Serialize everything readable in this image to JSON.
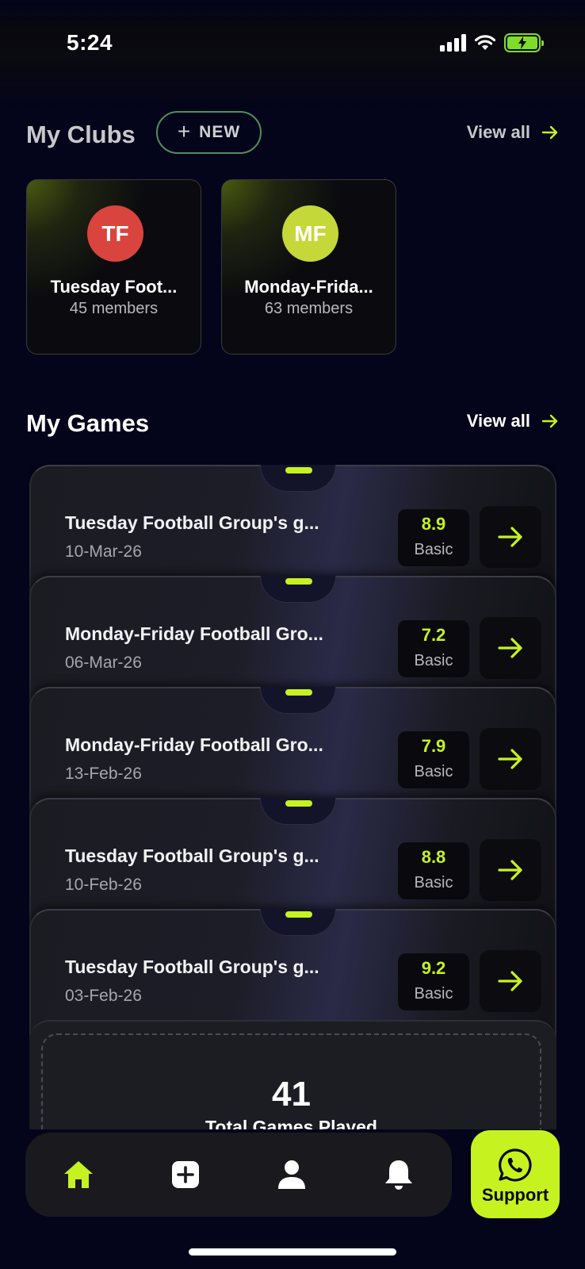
{
  "status_bar": {
    "time": "5:24"
  },
  "clubs": {
    "title": "My Clubs",
    "new_label": "NEW",
    "view_all": "View all",
    "items": [
      {
        "initials": "TF",
        "name": "Tuesday Foot...",
        "members": "45 members",
        "color": "#d9443f"
      },
      {
        "initials": "MF",
        "name": "Monday-Frida...",
        "members": "63 members",
        "color": "#c5d83a"
      }
    ]
  },
  "games": {
    "title": "My Games",
    "view_all": "View all",
    "items": [
      {
        "title": "Tuesday Football Group's g...",
        "date": "10-Mar-26",
        "score": "8.9",
        "tier": "Basic"
      },
      {
        "title": "Monday-Friday Football Gro...",
        "date": "06-Mar-26",
        "score": "7.2",
        "tier": "Basic"
      },
      {
        "title": "Monday-Friday Football Gro...",
        "date": "13-Feb-26",
        "score": "7.9",
        "tier": "Basic"
      },
      {
        "title": "Tuesday Football Group's g...",
        "date": "10-Feb-26",
        "score": "8.8",
        "tier": "Basic"
      },
      {
        "title": "Tuesday Football Group's g...",
        "date": "03-Feb-26",
        "score": "9.2",
        "tier": "Basic"
      }
    ],
    "total_value": "41",
    "total_label": "Total Games Played"
  },
  "tab_bar": {
    "tabs": [
      {
        "icon": "home-icon",
        "active": true
      },
      {
        "icon": "add-square-icon",
        "active": false
      },
      {
        "icon": "profile-icon",
        "active": false
      },
      {
        "icon": "bell-icon",
        "active": false
      }
    ]
  },
  "support": {
    "label": "Support",
    "icon": "whatsapp-icon"
  },
  "colors": {
    "accent": "#c6f31f",
    "background": "#04041a",
    "card": "#1b1b22"
  }
}
